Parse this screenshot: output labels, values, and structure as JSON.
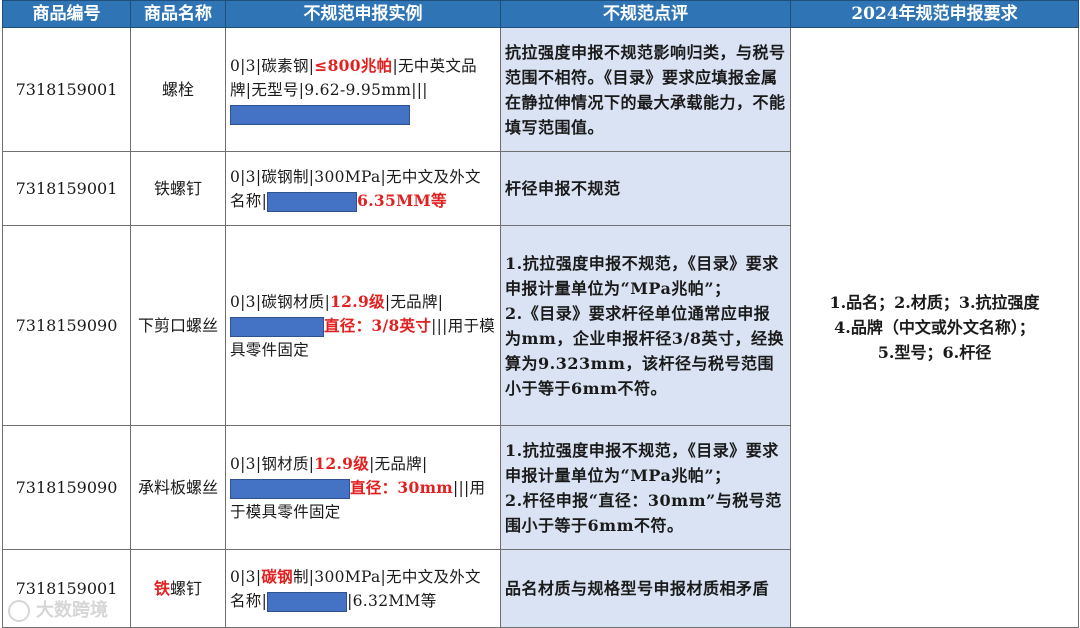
{
  "headers": [
    "商品编号",
    "商品名称",
    "不规范申报实例",
    "不规范点评",
    "2024年规范申报要求"
  ],
  "rows": [
    {
      "code": "7318159001",
      "name": "螺栓",
      "example": {
        "p1": "0|3|碳素钢|",
        "hl": "≤800兆帕",
        "p2": "|无中英文品牌|无型号|9.62-9.95mm|||"
      },
      "comment": "抗拉强度申报不规范影响归类，与税号范围不相符。《目录》要求应填报金属在静拉伸情况下的最大承载能力，不能填写范围值。"
    },
    {
      "code": "7318159001",
      "name": "铁螺钉",
      "example": {
        "p1": "0|3|碳钢制|300MPa|无中文及外文名称|",
        "hl": "6.35MM等"
      },
      "comment": "杆径申报不规范"
    },
    {
      "code": "7318159090",
      "name": "下剪口螺丝",
      "example": {
        "p1": "0|3|碳钢材质|",
        "hl": "12.9级",
        "p2": "|无品牌|",
        "hl2": "直径：3/8英寸",
        "p3": "|||用于模具零件固定"
      },
      "comment": "1.抗拉强度申报不规范，《目录》要求申报计量单位为“MPa兆帕”；\n2.《目录》要求杆径单位通常应申报为mm，企业申报杆径3/8英寸，经换算为9.323mm，该杆径与税号范围小于等于6mm不符。"
    },
    {
      "code": "7318159090",
      "name": "承料板螺丝",
      "example": {
        "p1": "0|3|钢材质|",
        "hl": "12.9级",
        "p2": "|无品牌|",
        "hl2": "直径：30mm",
        "p3": "|||用于模具零件固定"
      },
      "comment": "1.抗拉强度申报不规范，《目录》要求申报计量单位为“MPa兆帕”；\n2.杆径申报“直径：30mm”与税号范围小于等于6mm不符。"
    },
    {
      "code": "7318159001",
      "name_hl": "铁",
      "name_rest": "螺钉",
      "example": {
        "p1": "0|3|",
        "hl": "碳钢",
        "p2": "制|300MPa|无中文及外文名称|",
        "p3": "|6.32MM等"
      },
      "comment": "品名材质与规格型号申报材质相矛盾"
    }
  ],
  "requirement": {
    "line1": "1.品名；2.材质；3.抗拉强度",
    "line2": "4.品牌（中文或外文名称）；",
    "line3": "5.型号；6.杆径"
  },
  "watermark": "大数跨境",
  "colors": {
    "header_bg": "#2f75b5",
    "comment_bg": "#dae3f3",
    "highlight": "#e32020",
    "mask": "#4472c4"
  }
}
